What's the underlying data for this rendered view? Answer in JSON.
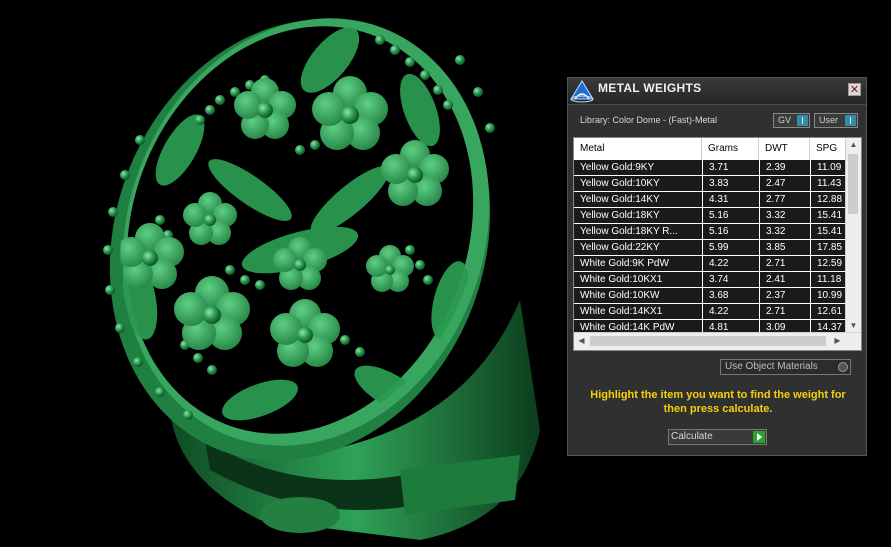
{
  "panel": {
    "title": "METAL WEIGHTS",
    "close_label": "✕",
    "library_label": "Library: Color Dome - (Fast)-Metal",
    "toggle_gv": "GV",
    "toggle_user": "User",
    "use_object_materials": "Use Object Materials",
    "hint": "Highlight the item you want to find the weight for then press calculate.",
    "calculate_label": "Calculate"
  },
  "table": {
    "headers": [
      "Metal",
      "Grams",
      "DWT",
      "SPG"
    ],
    "rows": [
      [
        "Yellow Gold:9KY",
        "3.71",
        "2.39",
        "11.09"
      ],
      [
        "Yellow Gold:10KY",
        "3.83",
        "2.47",
        "11.43"
      ],
      [
        "Yellow Gold:14KY",
        "4.31",
        "2.77",
        "12.88"
      ],
      [
        "Yellow Gold:18KY",
        "5.16",
        "3.32",
        "15.41"
      ],
      [
        "Yellow Gold:18KY R...",
        "5.16",
        "3.32",
        "15.41"
      ],
      [
        "Yellow Gold:22KY",
        "5.99",
        "3.85",
        "17.85"
      ],
      [
        "White Gold:9K PdW",
        "4.22",
        "2.71",
        "12.59"
      ],
      [
        "White Gold:10KX1",
        "3.74",
        "2.41",
        "11.18"
      ],
      [
        "White Gold:10KW",
        "3.68",
        "2.37",
        "10.99"
      ],
      [
        "White Gold:14KX1",
        "4.22",
        "2.71",
        "12.61"
      ],
      [
        "White Gold:14K PdW",
        "4.81",
        "3.09",
        "14.37"
      ]
    ]
  },
  "colors": {
    "ring_green": "#2e8f4e",
    "hint_yellow": "#f2d10c",
    "panel_bg": "#303030"
  }
}
